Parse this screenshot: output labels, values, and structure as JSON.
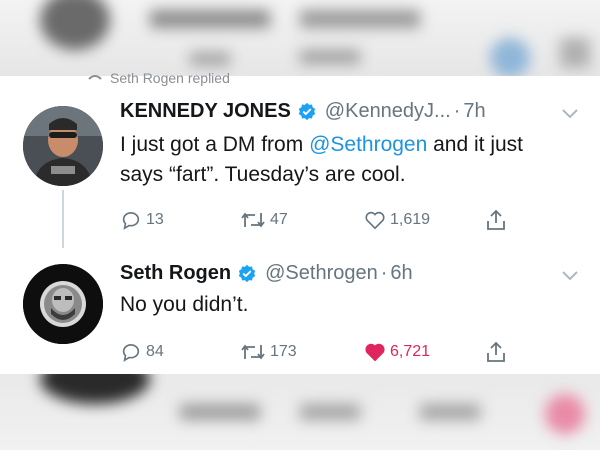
{
  "reply_context": "Seth Rogen replied",
  "tweets": [
    {
      "name": "KENNEDY JONES",
      "handle": "@KennedyJ...",
      "separator": "·",
      "time": "7h",
      "text_before": "I just got a DM from ",
      "mention": "@Sethrogen",
      "text_after": " and it just says “fart”.  Tuesday’s are cool.",
      "replies": "13",
      "retweets": "47",
      "likes": "1,619",
      "liked": false
    },
    {
      "name": "Seth Rogen",
      "handle": "@Sethrogen",
      "separator": "·",
      "time": "6h",
      "text": "No you didn’t.",
      "replies": "84",
      "retweets": "173",
      "likes": "6,721",
      "liked": true
    }
  ],
  "colors": {
    "accent": "#1b95e0",
    "verified": "#1da1f2",
    "like": "#e0245e",
    "muted": "#66757f"
  }
}
